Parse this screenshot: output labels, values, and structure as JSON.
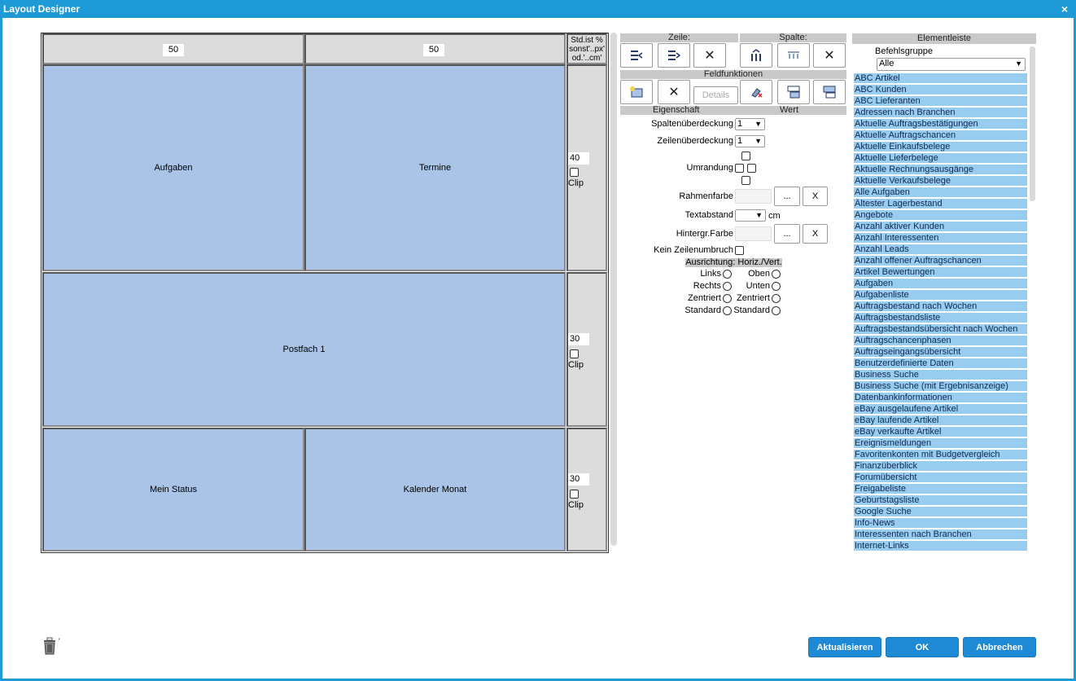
{
  "window": {
    "title": "Layout Designer",
    "close": "×"
  },
  "grid": {
    "col_widths": [
      "50",
      "50"
    ],
    "unit_hint": "Std.ist % sonst'..px' od.'..cm'",
    "rows": [
      {
        "height": "40",
        "clip": "Clip",
        "cells": [
          "Aufgaben",
          "Termine"
        ]
      },
      {
        "height": "30",
        "clip": "Clip",
        "cells": [
          "Postfach 1"
        ]
      },
      {
        "height": "30",
        "clip": "Clip",
        "cells": [
          "Mein Status",
          "Kalender Monat"
        ]
      }
    ]
  },
  "toolbar": {
    "zeile": "Zeile:",
    "spalte": "Spalte:",
    "feldfunktionen": "Feldfunktionen",
    "details": "Details",
    "delete_glyph": "✕"
  },
  "props": {
    "header_eigenschaft": "Eigenschaft",
    "header_wert": "Wert",
    "spaltenueberdeckung": "Spaltenüberdeckung",
    "spaltenueberdeckung_value": "1",
    "zeilenueberdeckung": "Zeilenüberdeckung",
    "zeilenueberdeckung_value": "1",
    "umrandung": "Umrandung",
    "rahmenfarbe": "Rahmenfarbe",
    "textabstand": "Textabstand",
    "textabstand_unit": "cm",
    "hintergrfarbe": "Hintergr.Farbe",
    "ellipsis": "...",
    "clear": "X",
    "kein_zeilenumbruch": "Kein Zeilenumbruch",
    "ausrichtung": "Ausrichtung: Horiz./Vert.",
    "horiz": [
      "Links",
      "Rechts",
      "Zentriert",
      "Standard"
    ],
    "vert": [
      "Oben",
      "Unten",
      "Zentriert",
      "Standard"
    ]
  },
  "elementleiste": {
    "title": "Elementleiste",
    "group_label": "Befehlsgruppe",
    "group_value": "Alle",
    "items": [
      "ABC Artikel",
      "ABC Kunden",
      "ABC Lieferanten",
      "Adressen nach Branchen",
      "Aktuelle Auftragsbestätigungen",
      "Aktuelle Auftragschancen",
      "Aktuelle Einkaufsbelege",
      "Aktuelle Lieferbelege",
      "Aktuelle Rechnungsausgänge",
      "Aktuelle Verkaufsbelege",
      "Alle Aufgaben",
      "Ältester Lagerbestand",
      "Angebote",
      "Anzahl aktiver Kunden",
      "Anzahl Interessenten",
      "Anzahl Leads",
      "Anzahl offener Auftragschancen",
      "Artikel Bewertungen",
      "Aufgaben",
      "Aufgabenliste",
      "Auftragsbestand nach Wochen",
      "Auftragsbestandsliste",
      "Auftragsbestandsübersicht nach Wochen",
      "Auftragschancenphasen",
      "Auftragseingangsübersicht",
      "Benutzerdefinierte Daten",
      "Business Suche",
      "Business Suche (mit Ergebnisanzeige)",
      "Datenbankinformationen",
      "eBay ausgelaufene Artikel",
      "eBay laufende Artikel",
      "eBay verkaufte Artikel",
      "Ereignismeldungen",
      "Favoritenkonten mit Budgetvergleich",
      "Finanzüberblick",
      "Forumübersicht",
      "Freigabeliste",
      "Geburtstagsliste",
      "Google Suche",
      "Info-News",
      "Interessenten nach Branchen",
      "Internet-Links"
    ]
  },
  "footer": {
    "aktualisieren": "Aktualisieren",
    "ok": "OK",
    "abbrechen": "Abbrechen",
    "trash_mark": "'"
  },
  "colors": {
    "accent": "#1e9bd7",
    "cell": "#a9c4e6",
    "list_item": "#99cdf0",
    "button": "#1e8ad6"
  }
}
